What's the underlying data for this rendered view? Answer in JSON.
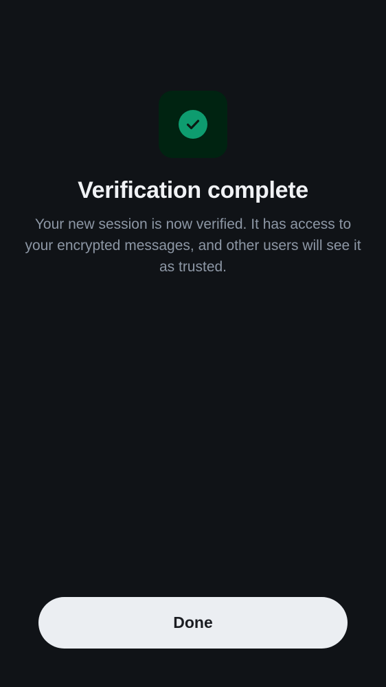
{
  "screen": {
    "title": "Verification complete",
    "description": "Your new session is now verified. It has access to your encrypted messages, and other users will see it as trusted.",
    "icon": "check-circle-icon",
    "done_label": "Done"
  },
  "colors": {
    "background": "#101317",
    "icon_tile": "#002311",
    "accent_green": "#0e9c6f",
    "title_text": "#f0f2f5",
    "body_text": "#8d97a5",
    "button_bg": "#ebeef2",
    "button_text": "#1b1d22"
  }
}
